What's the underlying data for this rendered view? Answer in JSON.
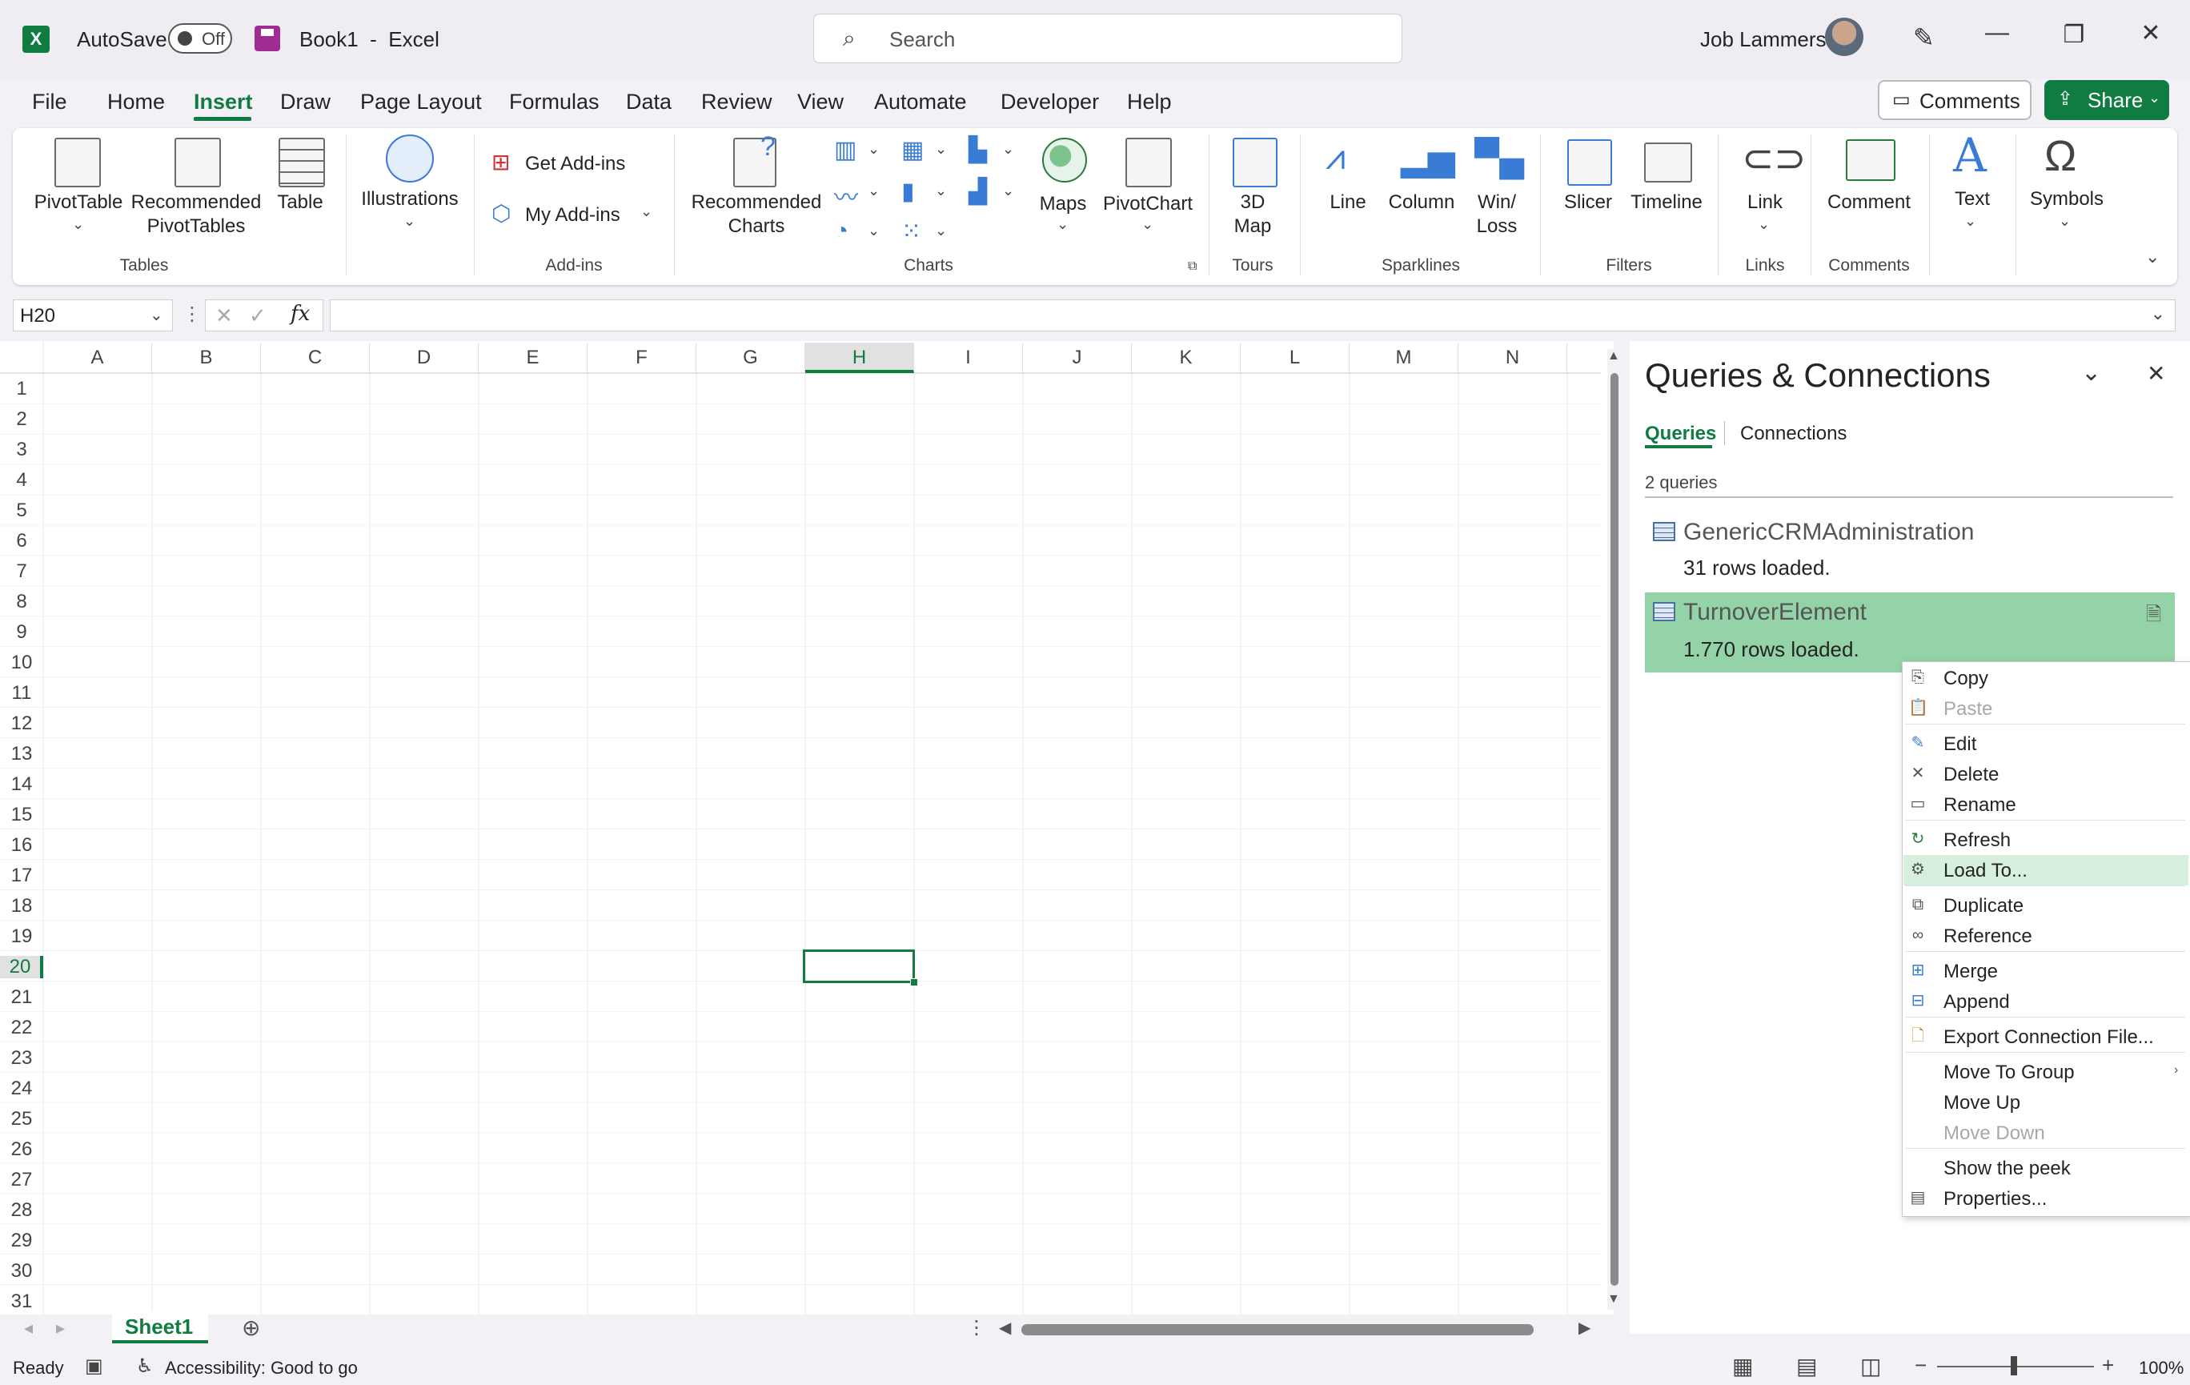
{
  "titlebar": {
    "app_letter": "X",
    "autosave_label": "AutoSave",
    "autosave_state": "Off",
    "document_title": "Book1  -  Excel",
    "search_placeholder": "Search",
    "user_name": "Job Lammers",
    "icons": [
      "excel-app-icon",
      "save-icon",
      "search-icon",
      "designer-pen-icon",
      "minimize-icon",
      "restore-icon",
      "close-icon"
    ]
  },
  "menu": {
    "tabs": [
      "File",
      "Home",
      "Insert",
      "Draw",
      "Page Layout",
      "Formulas",
      "Data",
      "Review",
      "View",
      "Automate",
      "Developer",
      "Help"
    ],
    "active_tab": "Insert",
    "comments_label": "Comments",
    "share_label": "Share"
  },
  "ribbon": {
    "tables": {
      "group": "Tables",
      "pivottable": "PivotTable",
      "rec_pivot_1": "Recommended",
      "rec_pivot_2": "PivotTables",
      "table": "Table"
    },
    "illustrations": {
      "label": "Illustrations"
    },
    "addins": {
      "group": "Add-ins",
      "get": "Get Add-ins",
      "my": "My Add-ins"
    },
    "charts": {
      "group": "Charts",
      "rec_1": "Recommended",
      "rec_2": "Charts",
      "maps": "Maps",
      "pivotchart": "PivotChart"
    },
    "tours": {
      "group": "Tours",
      "map_1": "3D",
      "map_2": "Map"
    },
    "sparklines": {
      "group": "Sparklines",
      "line": "Line",
      "column": "Column",
      "winloss_1": "Win/",
      "winloss_2": "Loss"
    },
    "filters": {
      "group": "Filters",
      "slicer": "Slicer",
      "timeline": "Timeline"
    },
    "links": {
      "group": "Links",
      "link": "Link"
    },
    "comments": {
      "group": "Comments",
      "comment": "Comment"
    },
    "text": {
      "label": "Text"
    },
    "symbols": {
      "label": "Symbols"
    }
  },
  "formula_bar": {
    "name_box": "H20",
    "fx": "fx",
    "formula": ""
  },
  "grid": {
    "columns": [
      "A",
      "B",
      "C",
      "D",
      "E",
      "F",
      "G",
      "H",
      "I",
      "J",
      "K",
      "L",
      "M",
      "N"
    ],
    "active_column": "H",
    "rows": [
      "1",
      "2",
      "3",
      "4",
      "5",
      "6",
      "7",
      "8",
      "9",
      "10",
      "11",
      "12",
      "13",
      "14",
      "15",
      "16",
      "17",
      "18",
      "19",
      "20",
      "21",
      "22",
      "23",
      "24",
      "25",
      "26",
      "27",
      "28",
      "29",
      "30",
      "31"
    ],
    "active_row": "20"
  },
  "panel": {
    "title": "Queries & Connections",
    "tabs": [
      "Queries",
      "Connections"
    ],
    "count": "2 queries",
    "queries": [
      {
        "name": "GenericCRMAdministration",
        "status": "31 rows loaded."
      },
      {
        "name": "TurnoverElement",
        "status": "1.770 rows loaded."
      }
    ]
  },
  "context_menu": {
    "items": [
      {
        "label": "Copy",
        "icon": "copy-icon",
        "enabled": true
      },
      {
        "label": "Paste",
        "icon": "paste-icon",
        "enabled": false
      },
      {
        "label": "Edit",
        "icon": "edit-icon",
        "enabled": true
      },
      {
        "label": "Delete",
        "icon": "delete-icon",
        "enabled": true
      },
      {
        "label": "Rename",
        "icon": "rename-icon",
        "enabled": true
      },
      {
        "label": "Refresh",
        "icon": "refresh-icon",
        "enabled": true
      },
      {
        "label": "Load To...",
        "icon": "load-to-icon",
        "enabled": true,
        "highlighted": true
      },
      {
        "label": "Duplicate",
        "icon": "duplicate-icon",
        "enabled": true
      },
      {
        "label": "Reference",
        "icon": "reference-icon",
        "enabled": true
      },
      {
        "label": "Merge",
        "icon": "merge-icon",
        "enabled": true
      },
      {
        "label": "Append",
        "icon": "append-icon",
        "enabled": true
      },
      {
        "label": "Export Connection File...",
        "icon": "export-icon",
        "enabled": true
      },
      {
        "label": "Move To Group",
        "icon": "",
        "enabled": true,
        "submenu": true
      },
      {
        "label": "Move Up",
        "icon": "",
        "enabled": true
      },
      {
        "label": "Move Down",
        "icon": "",
        "enabled": false
      },
      {
        "label": "Show the peek",
        "icon": "",
        "enabled": true
      },
      {
        "label": "Properties...",
        "icon": "properties-icon",
        "enabled": true
      }
    ]
  },
  "sheets": {
    "active": "Sheet1"
  },
  "status": {
    "ready": "Ready",
    "accessibility": "Accessibility: Good to go",
    "zoom": "100%"
  },
  "colors": {
    "accent": "#107c41",
    "selected_query_bg": "#94d2a7",
    "menu_highlight": "#d7f0dd"
  }
}
